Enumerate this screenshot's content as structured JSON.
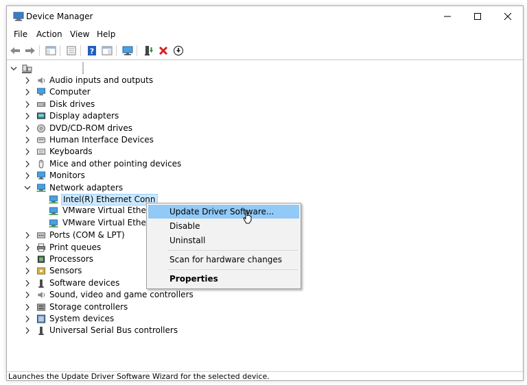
{
  "window": {
    "title": "Device Manager",
    "controls": [
      "minimize",
      "maximize",
      "close"
    ]
  },
  "menu": [
    "File",
    "Action",
    "View",
    "Help"
  ],
  "toolbar": {
    "buttons": [
      "back-arrow-icon",
      "forward-arrow-icon",
      "console-tree-icon",
      "properties-icon",
      "help-icon",
      "show-hide-icon",
      "monitor-icon",
      "update-driver-icon",
      "uninstall-x-icon",
      "download-icon"
    ],
    "colors": {
      "uninstall": "#d81e1e",
      "help": "#1f5fbf",
      "update": "#2e8b2e"
    }
  },
  "tree": {
    "categories": [
      {
        "label": "Audio inputs and outputs",
        "icon": "speaker-icon"
      },
      {
        "label": "Computer",
        "icon": "computer-icon"
      },
      {
        "label": "Disk drives",
        "icon": "disk-drive-icon"
      },
      {
        "label": "Display adapters",
        "icon": "display-adapter-icon"
      },
      {
        "label": "DVD/CD-ROM drives",
        "icon": "dvd-icon"
      },
      {
        "label": "Human Interface Devices",
        "icon": "hid-icon"
      },
      {
        "label": "Keyboards",
        "icon": "keyboard-icon"
      },
      {
        "label": "Mice and other pointing devices",
        "icon": "mouse-icon"
      },
      {
        "label": "Monitors",
        "icon": "monitor-icon"
      },
      {
        "label": "Network adapters",
        "icon": "network-icon",
        "expanded": true
      },
      {
        "label": "Ports (COM & LPT)",
        "icon": "port-icon"
      },
      {
        "label": "Print queues",
        "icon": "printer-icon"
      },
      {
        "label": "Processors",
        "icon": "processor-icon"
      },
      {
        "label": "Sensors",
        "icon": "sensor-icon"
      },
      {
        "label": "Software devices",
        "icon": "software-device-icon"
      },
      {
        "label": "Sound, video and game controllers",
        "icon": "sound-icon"
      },
      {
        "label": "Storage controllers",
        "icon": "storage-icon"
      },
      {
        "label": "System devices",
        "icon": "system-device-icon"
      },
      {
        "label": "Universal Serial Bus controllers",
        "icon": "usb-icon"
      }
    ],
    "network_children": [
      {
        "label": "Intel(R) Ethernet Conn",
        "selected": true
      },
      {
        "label": "VMware Virtual Ethern"
      },
      {
        "label": "VMware Virtual Ethern"
      }
    ]
  },
  "context_menu": {
    "items": [
      {
        "label": "Update Driver Software...",
        "highlighted": true
      },
      {
        "label": "Disable"
      },
      {
        "label": "Uninstall"
      },
      {
        "label": "Scan for hardware changes"
      },
      {
        "label": "Properties",
        "bold": true
      }
    ],
    "highlight_color": "#91c9f7"
  },
  "status": "Launches the Update Driver Software Wizard for the selected device."
}
